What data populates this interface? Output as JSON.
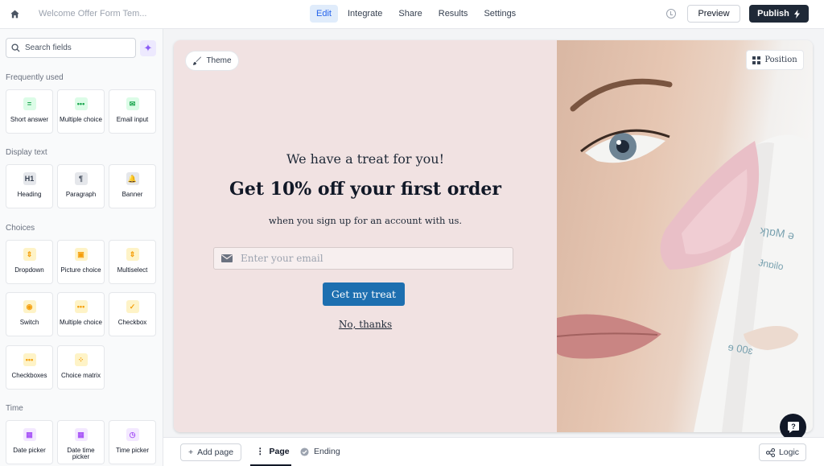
{
  "header": {
    "doc_title": "Welcome Offer Form Tem...",
    "tabs": [
      {
        "label": "Edit",
        "active": true
      },
      {
        "label": "Integrate",
        "active": false
      },
      {
        "label": "Share",
        "active": false
      },
      {
        "label": "Results",
        "active": false
      },
      {
        "label": "Settings",
        "active": false
      }
    ],
    "preview_label": "Preview",
    "publish_label": "Publish",
    "icons": [
      "home-icon",
      "history-icon",
      "bolt-icon"
    ]
  },
  "sidebar": {
    "search_placeholder": "Search fields",
    "sections": {
      "frequently_used": "Frequently used",
      "display_text": "Display text",
      "choices": "Choices",
      "time": "Time"
    },
    "frequently_used": [
      {
        "label": "Short answer",
        "icon": "short-answer-icon",
        "glyph": "="
      },
      {
        "label": "Multiple choice",
        "icon": "multiple-choice-icon",
        "glyph": "•••"
      },
      {
        "label": "Email input",
        "icon": "email-icon",
        "glyph": "✉"
      }
    ],
    "display_text": [
      {
        "label": "Heading",
        "icon": "heading-icon",
        "glyph": "H1"
      },
      {
        "label": "Paragraph",
        "icon": "paragraph-icon",
        "glyph": "¶"
      },
      {
        "label": "Banner",
        "icon": "banner-icon",
        "glyph": "🔔"
      }
    ],
    "choices": [
      {
        "label": "Dropdown",
        "icon": "dropdown-icon",
        "glyph": "⇕"
      },
      {
        "label": "Picture choice",
        "icon": "picture-choice-icon",
        "glyph": "▣"
      },
      {
        "label": "Multiselect",
        "icon": "multiselect-icon",
        "glyph": "⇕"
      },
      {
        "label": "Switch",
        "icon": "switch-icon",
        "glyph": "◉"
      },
      {
        "label": "Multiple choice",
        "icon": "multiple-choice-icon",
        "glyph": "•••"
      },
      {
        "label": "Checkbox",
        "icon": "checkbox-icon",
        "glyph": "✓"
      },
      {
        "label": "Checkboxes",
        "icon": "checkboxes-icon",
        "glyph": "•••"
      },
      {
        "label": "Choice matrix",
        "icon": "choice-matrix-icon",
        "glyph": "⁘"
      }
    ],
    "time": [
      {
        "label": "Date picker",
        "icon": "calendar-icon",
        "glyph": "▦"
      },
      {
        "label": "Date time picker",
        "icon": "calendar-icon",
        "glyph": "▦"
      },
      {
        "label": "Time picker",
        "icon": "clock-icon",
        "glyph": "◷"
      }
    ]
  },
  "canvas": {
    "theme_label": "Theme",
    "position_label": "Position",
    "pretitle": "We have a treat for you!",
    "headline": "Get 10% off your first order",
    "subtitle": "when you sign up for an account with us.",
    "email_placeholder": "Enter your email",
    "cta_label": "Get my treat",
    "decline_label": "No, thanks",
    "image": "woman-face-skincare-product-image",
    "colors": {
      "left_bg": "#f1e2e2",
      "cta": "#1d6fb0"
    }
  },
  "footer": {
    "add_page_label": "Add page",
    "page_label": "Page",
    "ending_label": "Ending",
    "logic_label": "Logic"
  }
}
